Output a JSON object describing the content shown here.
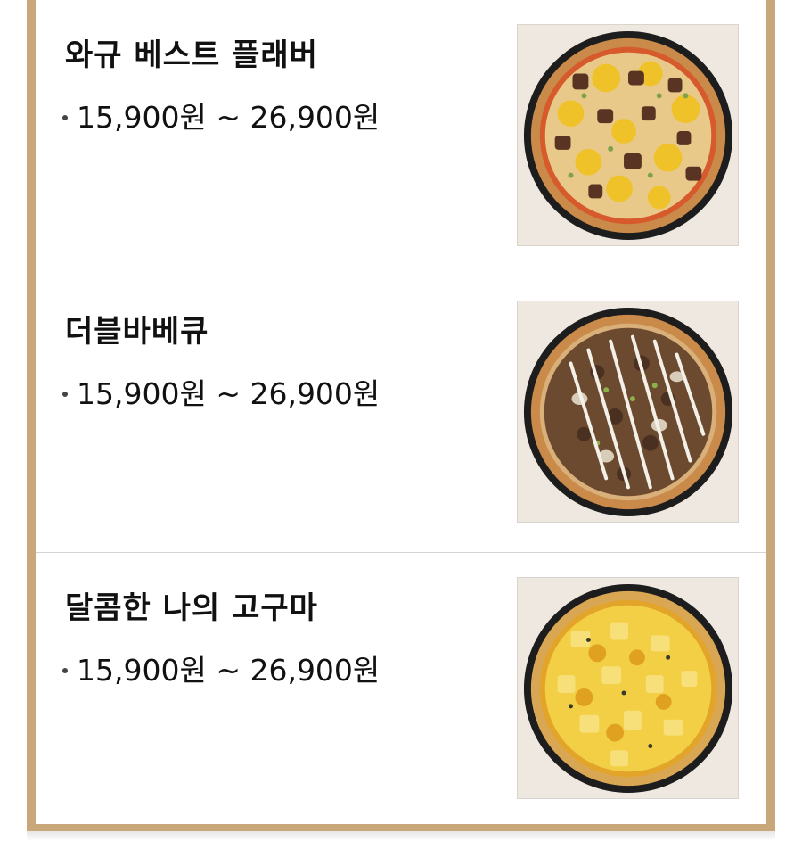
{
  "menu": {
    "items": [
      {
        "name": "와규 베스트 플래버",
        "price": "15,900원 ~ 26,900원",
        "image": "wagyu-best-flavor-pizza",
        "topping_color": "#f0c22a",
        "accent_color": "#5a3422"
      },
      {
        "name": "더블바베큐",
        "price": "15,900원 ~ 26,900원",
        "image": "double-bbq-pizza",
        "topping_color": "#6b4a30",
        "accent_color": "#f3f0e8"
      },
      {
        "name": "달콤한 나의 고구마",
        "price": "15,900원 ~ 26,900원",
        "image": "sweet-potato-pizza",
        "topping_color": "#f2cf45",
        "accent_color": "#e2a52a"
      }
    ]
  },
  "colors": {
    "frame": "#c9a77a",
    "divider": "#d4d4d4",
    "text": "#111111"
  }
}
